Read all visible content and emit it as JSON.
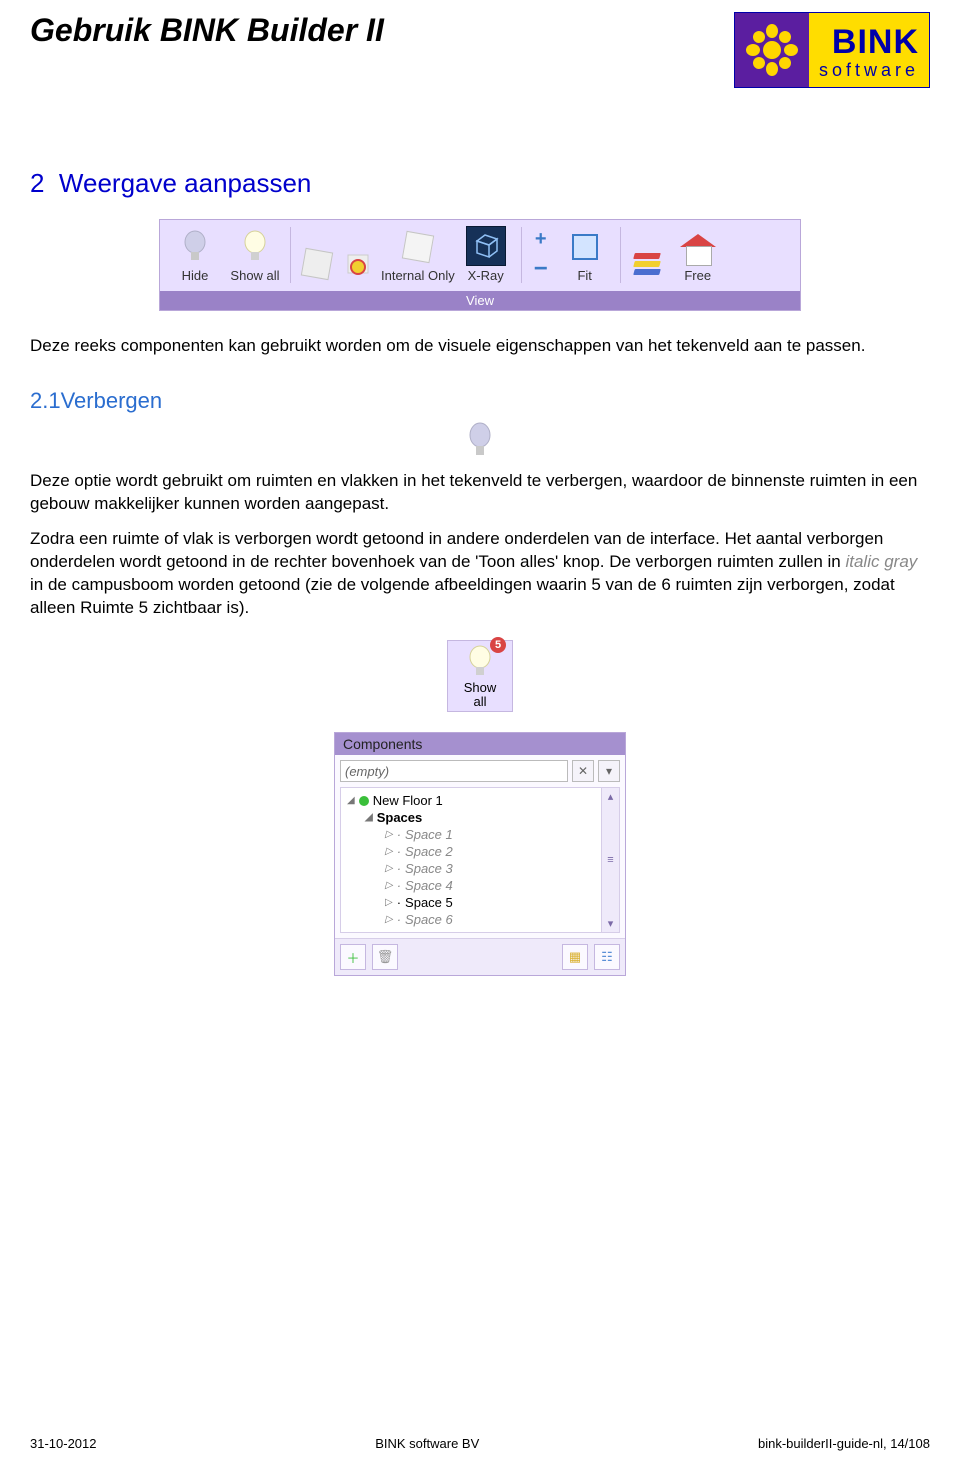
{
  "header": {
    "title": "Gebruik BINK Builder II",
    "logo": {
      "brand": "BINK",
      "sub": "software"
    }
  },
  "section": {
    "number": "2",
    "title": "Weergave aanpassen",
    "intro": "Deze reeks componenten kan gebruikt worden om de visuele eigenschappen van het tekenveld aan te passen."
  },
  "ribbon": {
    "title": "View",
    "buttons": [
      {
        "id": "hide",
        "label": "Hide"
      },
      {
        "id": "showall",
        "label": "Show all"
      },
      {
        "id": "cube1",
        "label": ""
      },
      {
        "id": "cube2",
        "label": ""
      },
      {
        "id": "internal",
        "label": "Internal Only"
      },
      {
        "id": "xray",
        "label": "X-Ray"
      },
      {
        "id": "plus",
        "label": ""
      },
      {
        "id": "minus",
        "label": ""
      },
      {
        "id": "fit",
        "label": "Fit"
      },
      {
        "id": "flags",
        "label": ""
      },
      {
        "id": "free",
        "label": "Free"
      }
    ]
  },
  "subsection": {
    "number": "2.1",
    "title": "Verbergen",
    "p1": "Deze optie wordt gebruikt om ruimten en vlakken in het tekenveld te verbergen, waardoor de binnenste ruimten in een gebouw makkelijker kunnen worden aangepast.",
    "p2a": "Zodra een ruimte of vlak is verborgen wordt getoond in andere onderdelen van de interface. Het aantal verborgen onderdelen wordt getoond in de rechter bovenhoek van de 'Toon alles' knop. De verborgen ruimten zullen in ",
    "p2_em": "italic gray",
    "p2b": " in de campusboom worden getoond (zie de volgende afbeeldingen waarin 5 van de 6 ruimten zijn verborgen, zodat alleen Ruimte 5 zichtbaar is)."
  },
  "showall": {
    "label_line1": "Show",
    "label_line2": "all",
    "badge": "5"
  },
  "panel": {
    "title": "Components",
    "emptyPlaceholder": "(empty)",
    "root": "New Floor 1",
    "group": "Spaces",
    "spaces": [
      {
        "label": "Space 1",
        "hidden": true
      },
      {
        "label": "Space 2",
        "hidden": true
      },
      {
        "label": "Space 3",
        "hidden": true
      },
      {
        "label": "Space 4",
        "hidden": true
      },
      {
        "label": "Space 5",
        "hidden": false
      },
      {
        "label": "Space 6",
        "hidden": true
      }
    ]
  },
  "footer": {
    "date": "31-10-2012",
    "company": "BINK software BV",
    "pageref": "bink-builderII-guide-nl, 14/108"
  }
}
